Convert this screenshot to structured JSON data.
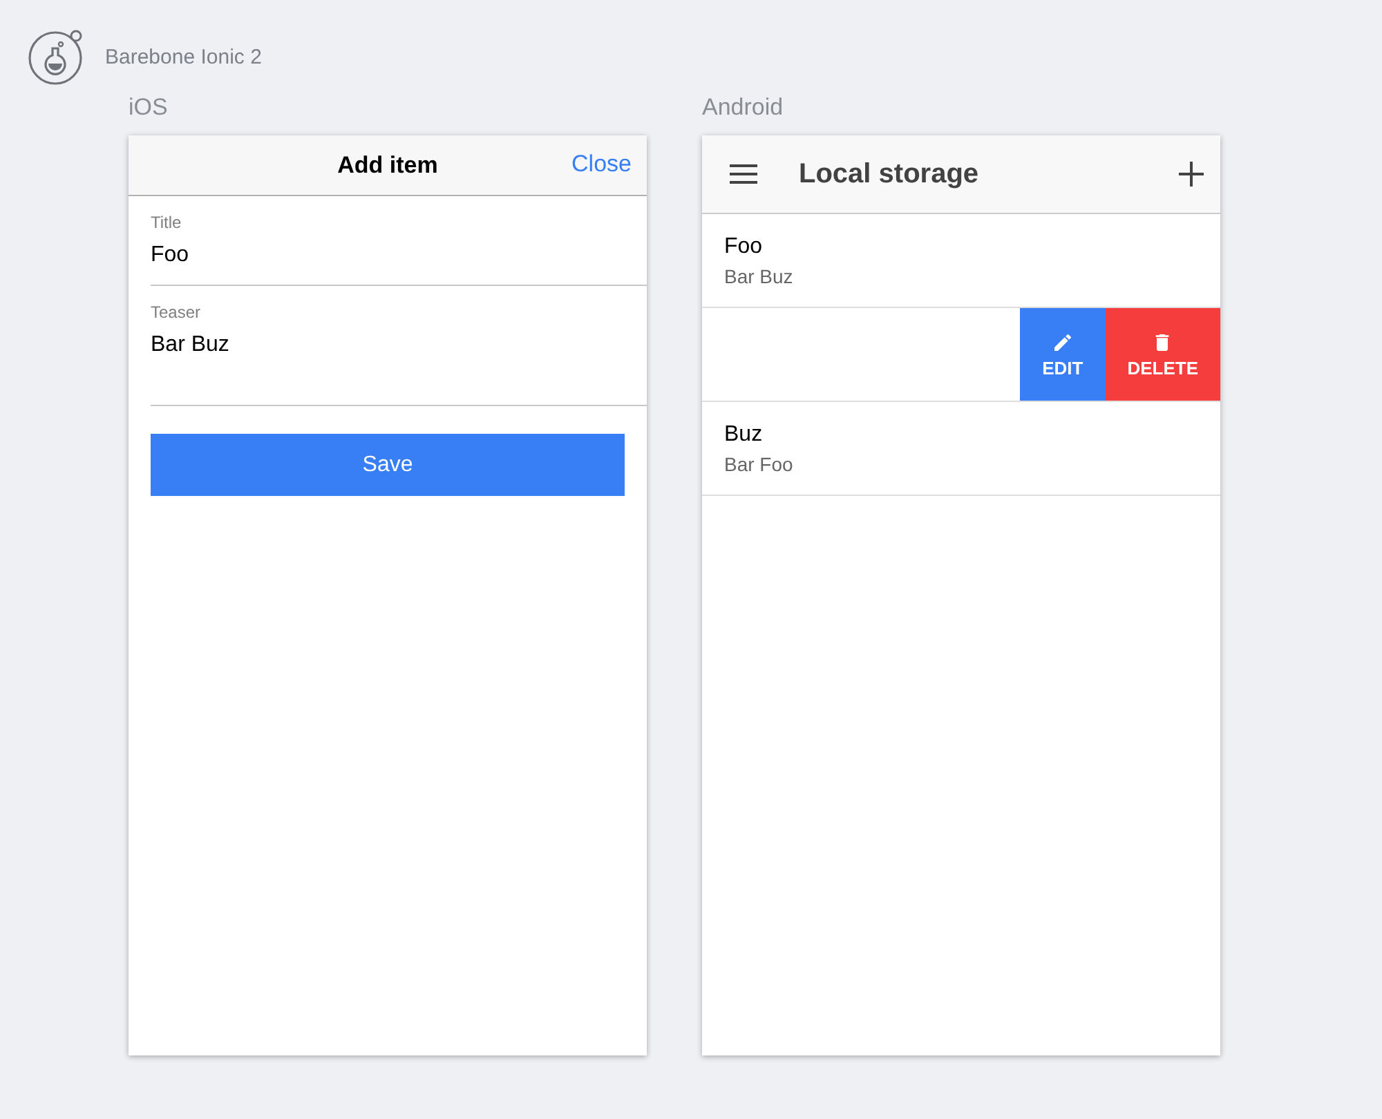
{
  "app": {
    "title": "Barebone Ionic 2"
  },
  "ios": {
    "platform_label": "iOS",
    "title": "Add item",
    "close": "Close",
    "fields": [
      {
        "label": "Title",
        "value": "Foo",
        "kind": "input"
      },
      {
        "label": "Teaser",
        "value": "Bar Buz",
        "kind": "textarea"
      }
    ],
    "save": "Save"
  },
  "android": {
    "platform_label": "Android",
    "title": "Local storage",
    "items": [
      {
        "kind": "text",
        "title": "Foo",
        "subtitle": "Bar Buz"
      },
      {
        "kind": "swiped",
        "options": [
          {
            "kind": "edit",
            "label": "EDIT"
          },
          {
            "kind": "delete",
            "label": "DELETE"
          }
        ]
      },
      {
        "kind": "text",
        "title": "Buz",
        "subtitle": "Bar Foo"
      }
    ]
  }
}
